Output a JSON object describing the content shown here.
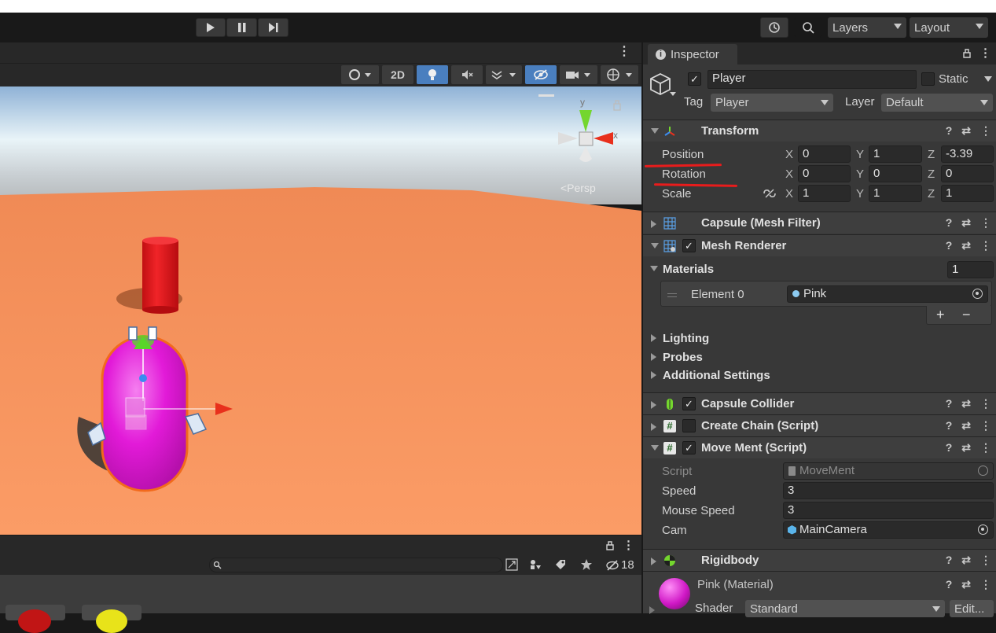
{
  "toolbar": {
    "layers_label": "Layers",
    "layout_label": "Layout"
  },
  "scene_view": {
    "mode_2d": "2D",
    "persp_label": "<Persp",
    "gizmo_y": "y",
    "gizmo_x": "x"
  },
  "bottom_panel": {
    "hidden_count": "18"
  },
  "inspector": {
    "tab_label": "Inspector",
    "object_name": "Player",
    "static_label": "Static",
    "tag_label": "Tag",
    "tag_value": "Player",
    "layer_label": "Layer",
    "layer_value": "Default",
    "transform": {
      "title": "Transform",
      "position_label": "Position",
      "rotation_label": "Rotation",
      "scale_label": "Scale",
      "position": {
        "x": "0",
        "y": "1",
        "z": "-3.39"
      },
      "rotation": {
        "x": "0",
        "y": "0",
        "z": "0"
      },
      "scale": {
        "x": "1",
        "y": "1",
        "z": "1"
      },
      "axis_x": "X",
      "axis_y": "Y",
      "axis_z": "Z"
    },
    "mesh_filter": {
      "title": "Capsule (Mesh Filter)"
    },
    "mesh_renderer": {
      "title": "Mesh Renderer",
      "materials_label": "Materials",
      "materials_count": "1",
      "element0_label": "Element 0",
      "element0_value": "Pink",
      "plus": "+",
      "minus": "−",
      "lighting": "Lighting",
      "probes": "Probes",
      "additional": "Additional Settings"
    },
    "capsule_collider": {
      "title": "Capsule Collider"
    },
    "create_chain": {
      "title": "Create Chain (Script)"
    },
    "move_ment": {
      "title": "Move Ment (Script)",
      "script_label": "Script",
      "script_value": "MoveMent",
      "speed_label": "Speed",
      "speed_value": "3",
      "mouse_speed_label": "Mouse Speed",
      "mouse_speed_value": "3",
      "cam_label": "Cam",
      "cam_value": "MainCamera"
    },
    "rigidbody": {
      "title": "Rigidbody"
    },
    "material": {
      "name": "Pink (Material)",
      "shader_label": "Shader",
      "shader_value": "Standard",
      "edit_label": "Edit..."
    }
  },
  "colors": {
    "accent_blue": "#4a7fbf",
    "annotation_red": "#e81c1c",
    "pink_capsule": "#e21ad8",
    "ground": "#f59a64"
  }
}
